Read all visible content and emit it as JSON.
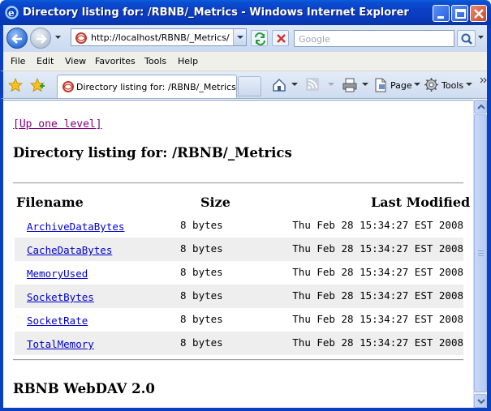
{
  "window": {
    "title": "Directory listing for: /RBNB/_Metrics - Windows Internet Explorer"
  },
  "address": {
    "url": "http://localhost/RBNB/_Metrics/",
    "search_placeholder": "Google"
  },
  "menu": [
    "File",
    "Edit",
    "View",
    "Favorites",
    "Tools",
    "Help"
  ],
  "tab": {
    "label": "Directory listing for: /RBNB/_Metrics"
  },
  "commands": {
    "page_label": "Page",
    "tools_label": "Tools"
  },
  "page": {
    "up_link": "[Up one level]",
    "heading": "Directory listing for: /RBNB/_Metrics",
    "columns": {
      "filename": "Filename",
      "size": "Size",
      "modified": "Last Modified"
    },
    "files": [
      {
        "name": "ArchiveDataBytes",
        "size": "8 bytes",
        "modified": "Thu Feb 28 15:34:27 EST 2008"
      },
      {
        "name": "CacheDataBytes",
        "size": "8 bytes",
        "modified": "Thu Feb 28 15:34:27 EST 2008"
      },
      {
        "name": "MemoryUsed",
        "size": "8 bytes",
        "modified": "Thu Feb 28 15:34:27 EST 2008"
      },
      {
        "name": "SocketBytes",
        "size": "8 bytes",
        "modified": "Thu Feb 28 15:34:27 EST 2008"
      },
      {
        "name": "SocketRate",
        "size": "8 bytes",
        "modified": "Thu Feb 28 15:34:27 EST 2008"
      },
      {
        "name": "TotalMemory",
        "size": "8 bytes",
        "modified": "Thu Feb 28 15:34:27 EST 2008"
      }
    ],
    "footer": "RBNB WebDAV 2.0"
  },
  "colors": {
    "titlebar": "#0a3bbf",
    "link": "#0000cc",
    "visited_link": "#800080",
    "row_alt": "#eeeeee"
  },
  "icons": [
    "ie-logo-icon",
    "minimize-icon",
    "maximize-icon",
    "close-icon",
    "back-arrow-icon",
    "forward-arrow-icon",
    "page-icon",
    "refresh-icon",
    "stop-icon",
    "search-icon",
    "favorites-star-icon",
    "add-favorite-icon",
    "home-icon",
    "feeds-icon",
    "print-icon",
    "page-menu-icon",
    "tools-gear-icon"
  ]
}
